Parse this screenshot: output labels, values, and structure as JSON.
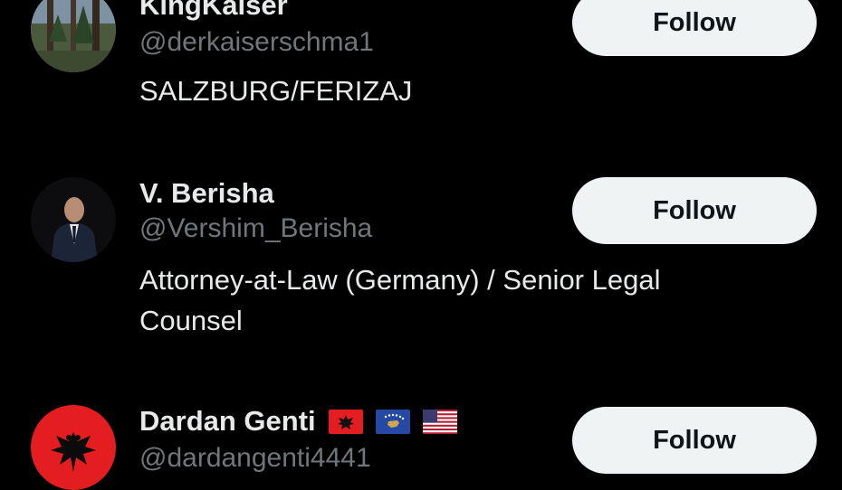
{
  "users": [
    {
      "name": "KingKaiser",
      "handle": "@derkaiserschma1",
      "bio": "SALZBURG/FERIZAJ",
      "follow_label": "Follow",
      "avatar_icon": "forest-photo-avatar"
    },
    {
      "name": "V. Berisha",
      "handle": "@Vershim_Berisha",
      "bio_line1": "Attorney-at-Law (Germany) / Senior Legal",
      "bio_line2": "Counsel",
      "follow_label": "Follow",
      "avatar_icon": "man-in-suit-avatar"
    },
    {
      "name": "Dardan Genti",
      "flags": [
        "albania-flag-icon",
        "kosovo-flag-icon",
        "usa-flag-icon"
      ],
      "handle": "@dardangenti4441",
      "follow_label": "Follow",
      "avatar_icon": "albanian-eagle-avatar"
    }
  ],
  "colors": {
    "background": "#000000",
    "name_text": "#e7e9ea",
    "handle_text": "#71767b",
    "follow_bg": "#eff3f4",
    "follow_text": "#0f1419"
  }
}
